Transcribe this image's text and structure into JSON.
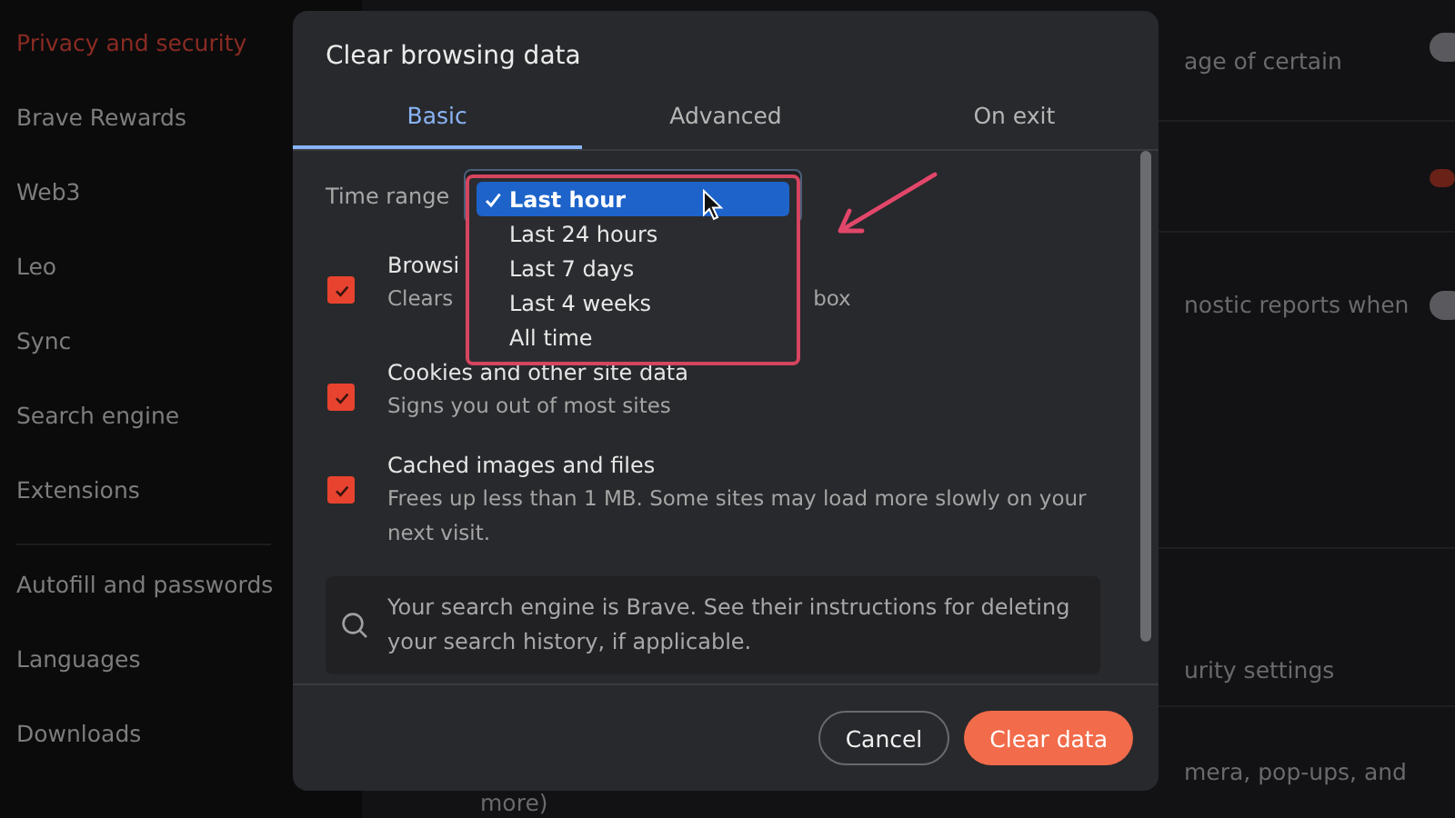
{
  "sidebar": {
    "items": [
      {
        "label": "Privacy and security",
        "selected": true
      },
      {
        "label": "Brave Rewards",
        "selected": false
      },
      {
        "label": "Web3",
        "selected": false
      },
      {
        "label": "Leo",
        "selected": false
      },
      {
        "label": "Sync",
        "selected": false
      },
      {
        "label": "Search engine",
        "selected": false
      },
      {
        "label": "Extensions",
        "selected": false
      },
      {
        "label": "Autofill and passwords",
        "selected": false
      },
      {
        "label": "Languages",
        "selected": false
      },
      {
        "label": "Downloads",
        "selected": false
      }
    ]
  },
  "settings": {
    "rows": [
      {
        "text": "age of certain",
        "on": false
      },
      {
        "on": true
      },
      {
        "text": "nostic reports when",
        "on": false
      },
      {
        "text": "urity settings"
      },
      {
        "text": "mera, pop-ups, and",
        "more": "more)"
      }
    ]
  },
  "dialog": {
    "title": "Clear browsing data",
    "tabs": [
      {
        "label": "Basic",
        "selected": true
      },
      {
        "label": "Advanced",
        "selected": false
      },
      {
        "label": "On exit",
        "selected": false
      }
    ],
    "time_range": {
      "label": "Time range",
      "options": [
        {
          "label": "Last hour",
          "selected": true
        },
        {
          "label": "Last 24 hours",
          "selected": false
        },
        {
          "label": "Last 7 days",
          "selected": false
        },
        {
          "label": "Last 4 weeks",
          "selected": false
        },
        {
          "label": "All time",
          "selected": false
        }
      ]
    },
    "items": [
      {
        "title": "Browsi",
        "description": "Clears",
        "description_end": "box",
        "checked": true
      },
      {
        "title": "Cookies and other site data",
        "description": "Signs you out of most sites",
        "checked": true
      },
      {
        "title": "Cached images and files",
        "description": "Frees up less than 1 MB. Some sites may load more slowly on your next visit.",
        "checked": true
      }
    ],
    "info": "Your search engine is Brave. See their instructions for deleting your search history, if applicable.",
    "buttons": [
      {
        "label": "Cancel",
        "kind": "secondary"
      },
      {
        "label": "Clear data",
        "kind": "primary"
      }
    ]
  }
}
